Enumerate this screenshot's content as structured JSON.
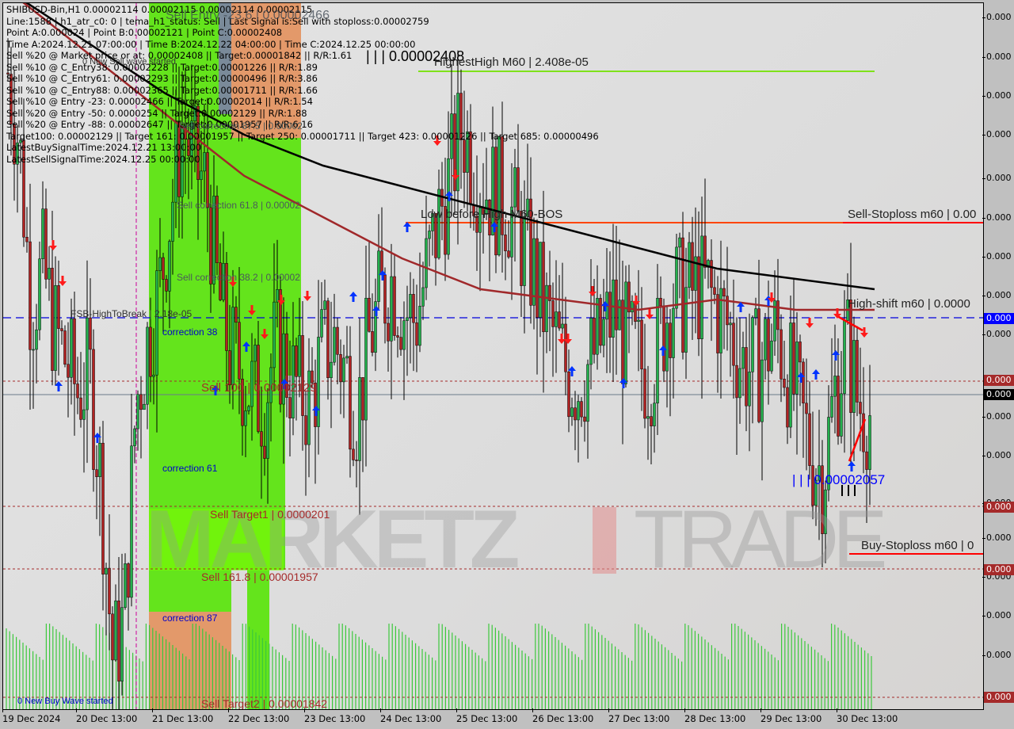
{
  "chart_data": {
    "type": "candlestick",
    "symbol": "SHIBUSD-Bin",
    "timeframe": "H1",
    "title": "SHIBUSD-Bin,H1  0.00002114 0.00002115 0.00002114 0.00002115",
    "ohlc_header": {
      "open": "0.00002114",
      "high": "0.00002115",
      "low": "0.00002114",
      "close": "0.00002115"
    },
    "x_tick_labels": [
      "19 Dec 2024",
      "20 Dec 13:00",
      "21 Dec 13:00",
      "22 Dec 13:00",
      "23 Dec 13:00",
      "24 Dec 13:00",
      "25 Dec 13:00",
      "26 Dec 13:00",
      "27 Dec 13:00",
      "28 Dec 13:00",
      "29 Dec 13:00",
      "30 Dec 13:00"
    ],
    "y_tick_labels": [
      "0.000",
      "0.000",
      "0.000",
      "0.000",
      "0.000",
      "0.000",
      "0.000",
      "0.000",
      "0.000",
      "0.000",
      "0.000",
      "0.000",
      "0.000",
      "0.000",
      "0.000",
      "0.000",
      "0.000"
    ],
    "y_badges": [
      {
        "text": "0.000",
        "color": "#0000ff",
        "level": "fsb-high-to-break"
      },
      {
        "text": "0.000",
        "color": "#a52a2a",
        "level": "sell-100"
      },
      {
        "text": "0.000",
        "color": "#000000",
        "level": "current-price"
      },
      {
        "text": "0.000",
        "color": "#a52a2a",
        "level": "sell-target1"
      },
      {
        "text": "0.000",
        "color": "#a52a2a",
        "level": "sell-161.8"
      },
      {
        "text": "0.000",
        "color": "#a52a2a",
        "level": "sell-target2"
      }
    ],
    "price_levels": {
      "highest_high": 2.408e-05,
      "sell_entry_23_6": 2.466e-05,
      "fsb_high_to_break": 2.18e-05,
      "sell_100": 2.129e-05,
      "current": 2.115e-05,
      "lowest_low": 2.057e-05,
      "sell_target1": 2.01e-05,
      "sell_161_8": 1.957e-05,
      "sell_target2": 1.842e-05
    },
    "y_range": [
      1.84e-05,
      2.51e-05
    ],
    "price_path": [
      2.45e-05,
      2.38e-05,
      2.22e-05,
      2.26e-05,
      2.2e-05,
      2.17e-05,
      2.14e-05,
      2.16e-05,
      2.05e-05,
      1.88e-05,
      1.92e-05,
      2.13e-05,
      2.19e-05,
      2.24e-05,
      2.32e-05,
      2.4e-05,
      2.36e-05,
      2.34e-05,
      2.24e-05,
      2.18e-05,
      2.16e-05,
      2.14e-05,
      2.13e-05,
      2.19e-05,
      2.16e-05,
      2.14e-05,
      2.13e-05,
      2.18e-05,
      2.19e-05,
      2.16e-05,
      2.12e-05,
      2.19e-05,
      2.23e-05,
      2.25e-05,
      2.22e-05,
      2.21e-05,
      2.26e-05,
      2.31e-05,
      2.35e-05,
      2.4e-05,
      2.36e-05,
      2.34e-05,
      2.33e-05,
      2.32e-05,
      2.29e-05,
      2.26e-05,
      2.22e-05,
      2.19e-05,
      2.16e-05,
      2.15e-05,
      2.17e-05,
      2.19e-05,
      2.22e-05,
      2.19e-05,
      2.17e-05,
      2.16e-05,
      2.19e-05,
      2.24e-05,
      2.23e-05,
      2.24e-05,
      2.24e-05,
      2.22e-05,
      2.2e-05,
      2.17e-05,
      2.16e-05,
      2.18e-05,
      2.2e-05,
      2.16e-05,
      2.12e-05,
      2.08e-05,
      2.06e-05,
      2.14e-05,
      2.19e-05,
      2.13e-05,
      2.12e-05
    ],
    "ma_black": [
      2.53e-05,
      2.48e-05,
      2.43e-05,
      2.39e-05,
      2.36e-05,
      2.34e-05,
      2.32e-05,
      2.3e-05,
      2.28e-05,
      2.26e-05,
      2.25e-05,
      2.24e-05
    ],
    "ma_red": [
      2.53e-05,
      2.47e-05,
      2.41e-05,
      2.35e-05,
      2.31e-05,
      2.27e-05,
      2.24e-05,
      2.23e-05,
      2.22e-05,
      2.23e-05,
      2.22e-05,
      2.22e-05
    ],
    "volume_note": "green volume histogram along bottom"
  },
  "info_panel": [
    "SHIBUSD-Bin,H1  0.00002114 0.00002115 0.00002114 0.00002115",
    "Line:1588 | h1_atr_c0: 0 | tema_h1_status: Sell | Last Signal is:Sell with stoploss:0.00002759",
    "Point A:0.000024 | Point B:0.00002121 | Point C:0.00002408",
    "Time A:2024.12.21 07:00:00 | Time B:2024.12.22 04:00:00 | Time C:2024.12.25 00:00:00",
    "Sell %20 @ Market price or at: 0.00002408 || Target:0.00001842 || R/R:1.61",
    "Sell %10 @ C_Entry38: 0.00002228 || Target:0.00001226 || R/R:1.89",
    "Sell %10 @ C_Entry61: 0.00002293 || Target:0.00000496 || R/R:3.86",
    "Sell %10 @ C_Entry88: 0.00002365 || Target:0.00001711 || R/R:1.66",
    "Sell %10 @ Entry -23: 0.00002466 || Target:0.00002014 || R/R:1.54",
    "Sell %20 @ Entry -50: 0.0000254 || Target:0.00002129 || R/R:1.88",
    "Sell %20 @ Entry -88: 0.00002647 || Target:0.00001957 || R/R:6.16",
    "Target100: 0.00002129 || Target 161: 0.00001957 || Target 250: 0.00001711 || Target 423: 0.00001226 || Target 685: 0.00000496",
    "LatestBuySignalTime:2024.12.21 13:00:00",
    "LatestSellSignalTime:2024.12.25 00:00:00"
  ],
  "labels": {
    "sell_entry": "Sell Entry -23.6 | 0.00002466",
    "new_sell_wave": "0 New Sell wave started",
    "sell_corr_875": "Sell correction 87.5 | 0.00002",
    "sell_corr_618": "Sell correction 61.8 | 0.00002",
    "sell_corr_382": "Sell correction 38.2 | 0.00002",
    "fsb": "FSB-HighToBreak | 2.18e-05",
    "corr38": "correction 38",
    "sell100": "Sell 100 | 0.00002129",
    "corr61": "correction 61",
    "sell_target1": "Sell Target1 | 0.0000201",
    "sell_1618": "Sell 161.8 | 0.00001957",
    "corr87": "correction 87",
    "sell_target2": "Sell Target2 | 0.00001842",
    "new_buy_wave": "0 New Buy Wave started",
    "highest_high_mark": "| | | 0.00002408",
    "highest_high": "HighestHigh   M60 | 2.408e-05",
    "low_before_high": "Low before High   M60-BOS",
    "sell_stoploss": "Sell-Stoploss m60 | 0.00",
    "high_shift": "High-shift m60 | 0.0000",
    "lowest_low_mark": "| | | 0.00002057",
    "buy_stoploss": "Buy-Stoploss m60 | 0",
    "watermark_left": "MARKETZ",
    "watermark_right": "TRADE"
  },
  "colors": {
    "bull": "#22b14c",
    "bear": "#b22222",
    "zone_green": "#64e41c",
    "zone_orange": "#e3996a",
    "zone_gray": "#7a8a99",
    "ma_red": "#a0282a",
    "level_blue": "#0000dd",
    "level_brown": "#a52a2a",
    "stoploss_red": "#ff0000",
    "highest_green": "#7fe21a"
  }
}
